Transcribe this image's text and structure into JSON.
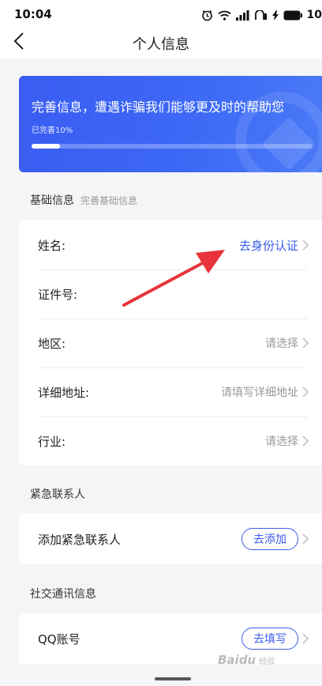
{
  "status_bar": {
    "time": "10:04",
    "battery": "10"
  },
  "nav": {
    "title": "个人信息"
  },
  "banner": {
    "title": "完善信息，遭遇诈骗我们能够更及时的帮助您",
    "progress_label": "已完善10%",
    "progress": 0.1
  },
  "basic_info": {
    "title": "基础信息",
    "subtitle": "完善基础信息",
    "rows": [
      {
        "label": "姓名:",
        "value": "去身份认证"
      },
      {
        "label": "证件号:",
        "value": ""
      },
      {
        "label": "地区:",
        "value": "请选择"
      },
      {
        "label": "详细地址:",
        "value": "请填写详细地址"
      },
      {
        "label": "行业:",
        "value": "请选择"
      }
    ]
  },
  "emergency": {
    "title": "紧急联系人",
    "row_label": "添加紧急联系人",
    "button": "去添加"
  },
  "social": {
    "title": "社交通讯信息",
    "row_label": "QQ账号",
    "button": "去填写"
  },
  "watermark": {
    "brand": "Baidu",
    "sub": "经验"
  },
  "colors": {
    "accent": "#3a5ce9",
    "arrow": "#e8333a",
    "banner": "#3c68f5"
  }
}
